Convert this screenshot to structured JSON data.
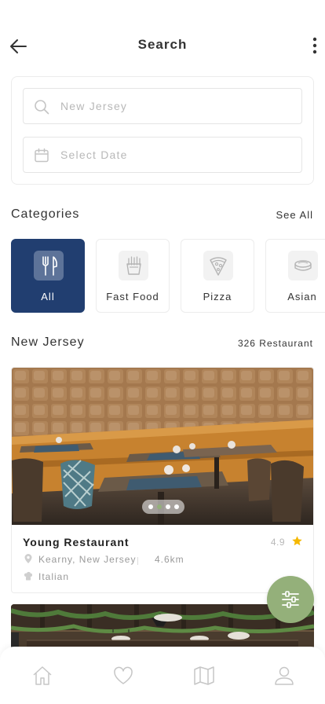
{
  "header": {
    "title": "Search",
    "back_icon": "arrow-left-icon",
    "more_icon": "more-vertical-icon"
  },
  "search": {
    "location_placeholder": "New Jersey",
    "date_placeholder": "Select Date",
    "location_icon": "search-icon",
    "date_icon": "calendar-icon"
  },
  "categories": {
    "title": "Categories",
    "see_all": "See All",
    "items": [
      {
        "label": "All",
        "icon": "utensils-icon",
        "selected": true
      },
      {
        "label": "Fast Food",
        "icon": "fries-icon",
        "selected": false
      },
      {
        "label": "Pizza",
        "icon": "pizza-icon",
        "selected": false
      },
      {
        "label": "Asian",
        "icon": "sushi-icon",
        "selected": false
      }
    ]
  },
  "results": {
    "title": "New Jersey",
    "count": "326 Restaurant",
    "restaurants": [
      {
        "name": "Young Restaurant",
        "rating": "4.9",
        "location": "Kearny, New Jersey",
        "distance": "4.6km",
        "cuisine": "Italian",
        "carousel_pages": 4,
        "carousel_active": 2
      }
    ]
  },
  "fab": {
    "icon": "filter-sliders-icon"
  },
  "tabbar": {
    "items": [
      {
        "icon": "home-icon"
      },
      {
        "icon": "heart-icon"
      },
      {
        "icon": "map-icon"
      },
      {
        "icon": "user-icon"
      }
    ]
  },
  "colors": {
    "accent_navy": "#213e70",
    "accent_green": "#94b07a",
    "star": "#f5b800"
  }
}
